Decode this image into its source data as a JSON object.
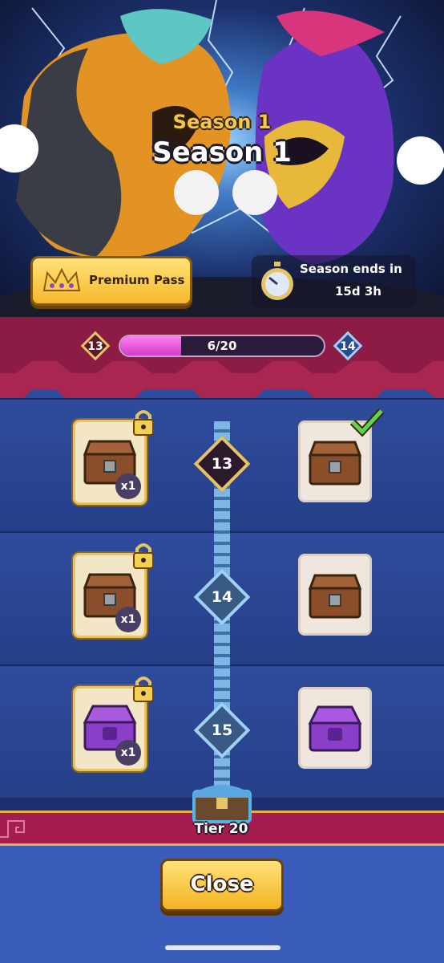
{
  "hero": {
    "season_small": "Season 1",
    "season_big": "Season 1",
    "premium_label": "Premium Pass",
    "season_ends_label": "Season ends in",
    "season_ends_value": "15d 3h"
  },
  "progress": {
    "current_tier": "13",
    "next_tier": "14",
    "text": "6/20",
    "fraction": 0.3
  },
  "tiers": [
    {
      "tier": "13",
      "premium_reward": {
        "item": "wooden-chest",
        "count": "x1",
        "locked": true
      },
      "free_reward": {
        "item": "wooden-chest",
        "claimed": true
      }
    },
    {
      "tier": "14",
      "premium_reward": {
        "item": "wooden-chest",
        "count": "x1",
        "locked": true
      },
      "free_reward": {
        "item": "wooden-chest",
        "claimed": false
      }
    },
    {
      "tier": "15",
      "premium_reward": {
        "item": "purple-chest",
        "count": "x1",
        "locked": true
      },
      "free_reward": {
        "item": "purple-chest",
        "claimed": false
      }
    }
  ],
  "final": {
    "label": "Tier 20"
  },
  "footer": {
    "close_label": "Close"
  },
  "colors": {
    "accent_gold": "#f3b322",
    "band_crimson": "#8c1b46",
    "row_blue": "#2f4c9c",
    "progress_pink": "#e14fd6"
  }
}
